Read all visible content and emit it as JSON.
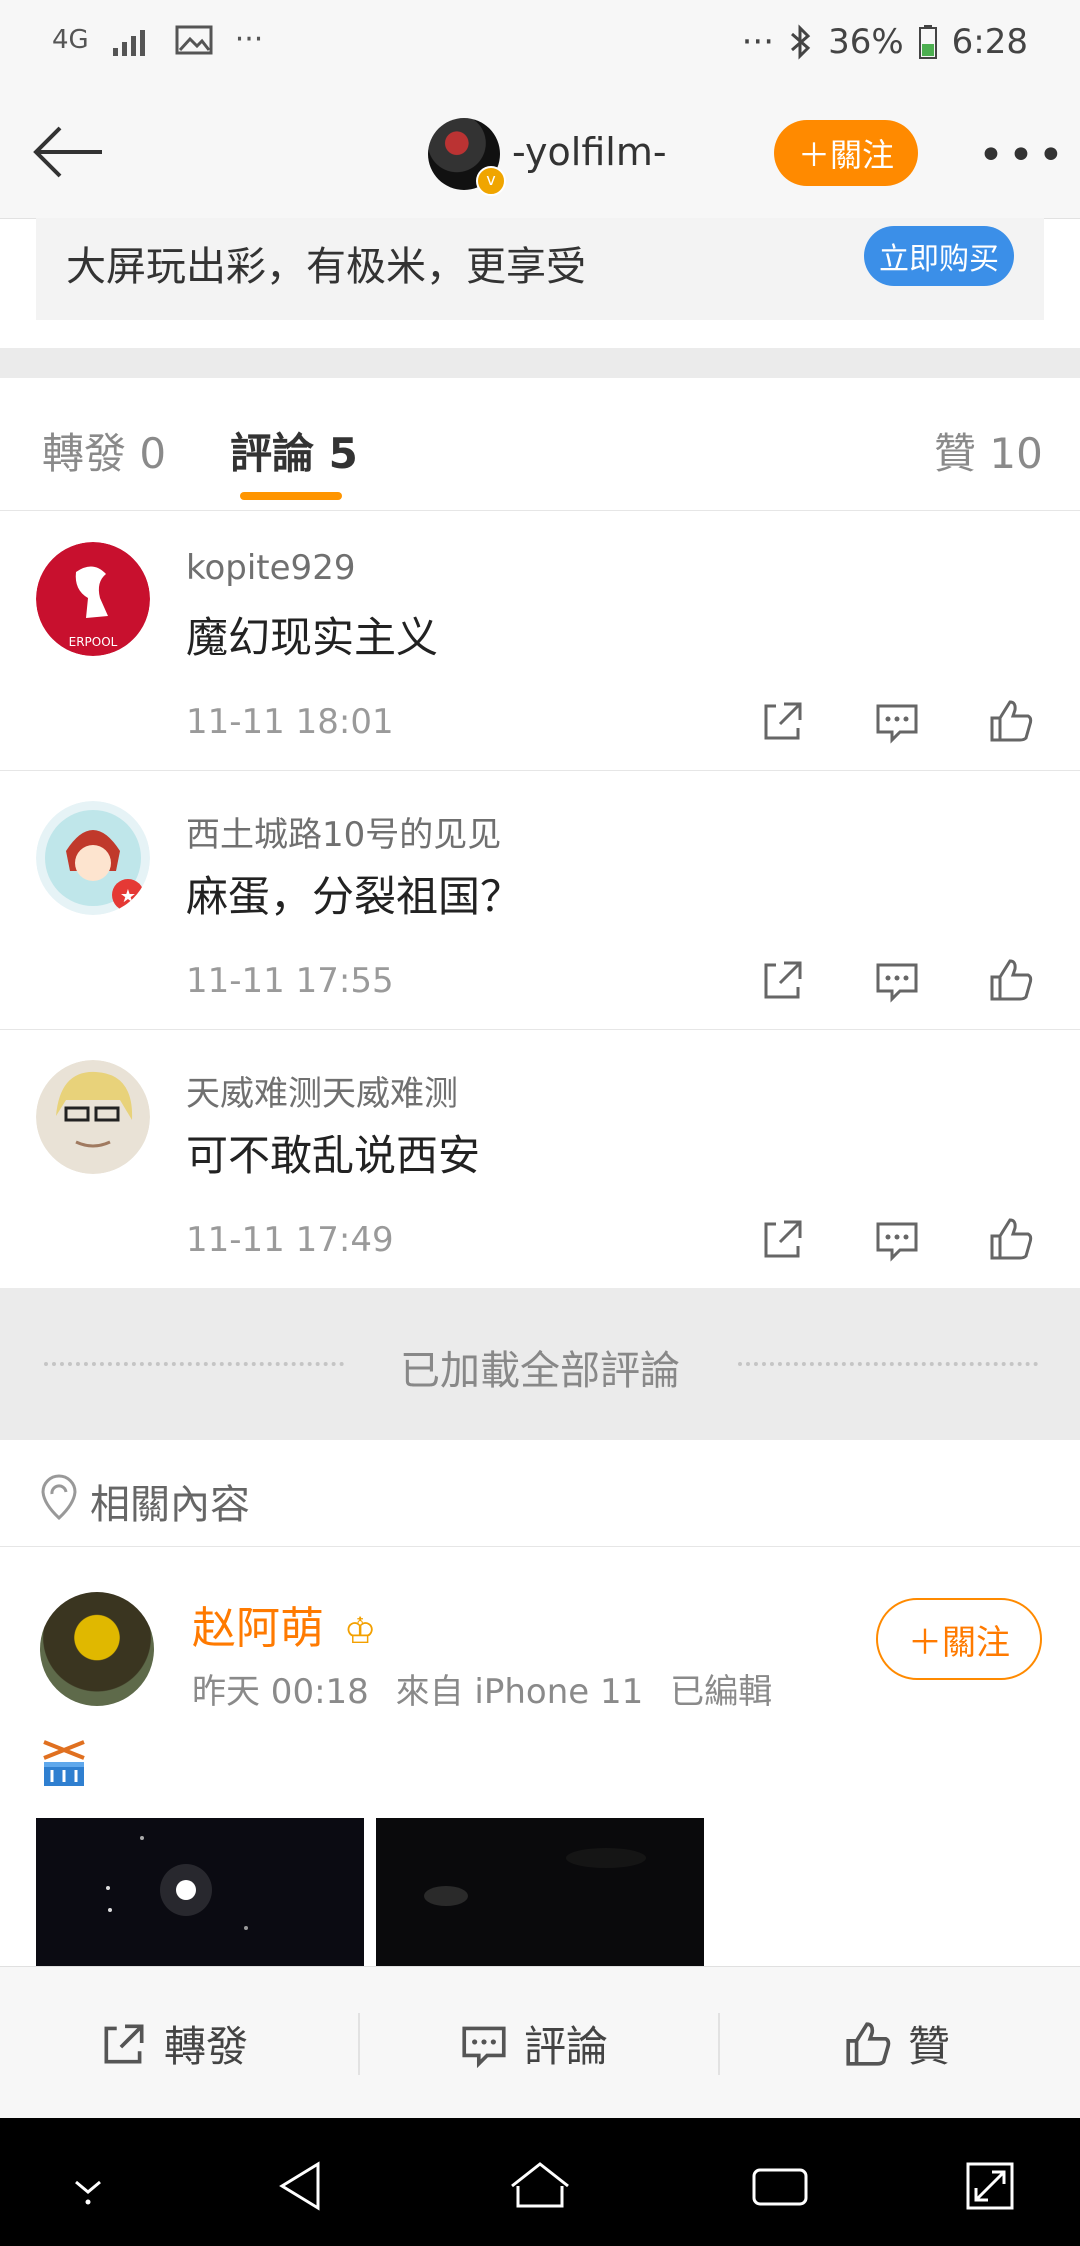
{
  "status_bar": {
    "network": "4G",
    "left_more": "···",
    "right_more": "···",
    "battery": "36%",
    "time": "6:28"
  },
  "nav": {
    "username": "-yolfilm-",
    "follow_label": "＋關注"
  },
  "ad": {
    "text": "大屏玩出彩，有极米，更享受",
    "buy_label": "立即购买"
  },
  "tabs": {
    "repost": "轉發 0",
    "comments": "評論 5",
    "likes": "贊 10"
  },
  "comments": [
    {
      "user": "kopite929",
      "text": "魔幻现实主义",
      "time": "11-11 18:01"
    },
    {
      "user": "西土城路10号的见见",
      "text": "麻蛋，分裂祖国？",
      "time": "11-11 17:55"
    },
    {
      "user": "天威难测天威难测",
      "text": "可不敢乱说西安",
      "time": "11-11 17:49"
    }
  ],
  "loaded_all": "已加載全部評論",
  "related": {
    "label": "相關內容"
  },
  "post": {
    "author": "赵阿萌",
    "time": "昨天 00:18",
    "source": "來自 iPhone 11",
    "edited": "已編輯",
    "follow_label": "＋關注"
  },
  "bottom_bar": {
    "repost": "轉發",
    "comment": "評論",
    "like": "贊"
  },
  "colors": {
    "accent": "#ff8a00",
    "buy_button": "#3b8fe8",
    "tab_underline": "#ff9500",
    "author_name": "#ff7a00"
  }
}
